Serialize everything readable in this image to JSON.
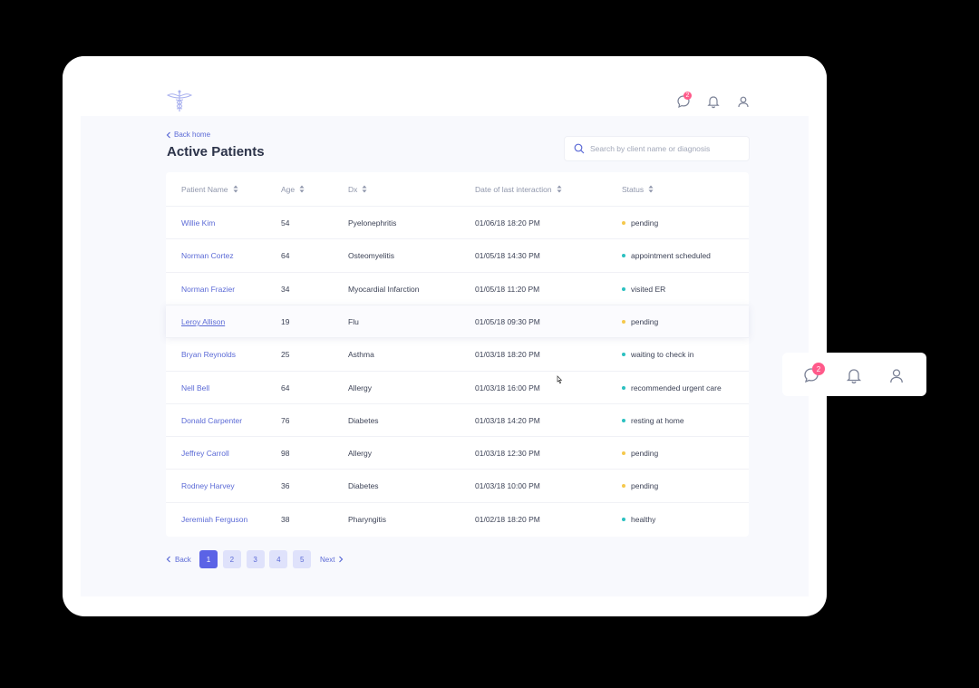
{
  "header": {
    "messages_badge": "2",
    "icons": [
      "chat-icon",
      "bell-icon",
      "user-icon"
    ]
  },
  "page": {
    "back_label": "Back home",
    "title": "Active Patients",
    "search_placeholder": "Search by client name or diagnosis"
  },
  "table": {
    "columns": [
      "Patient Name",
      "Age",
      "Dx",
      "Date of last interaction",
      "Status"
    ],
    "rows": [
      {
        "name": "Willie Kim",
        "age": "54",
        "dx": "Pyelonephritis",
        "date": "01/06/18 18:20 PM",
        "status": "pending",
        "status_color": "#f5c84c"
      },
      {
        "name": "Norman Cortez",
        "age": "64",
        "dx": "Osteomyelitis",
        "date": "01/05/18 14:30 PM",
        "status": "appointment scheduled",
        "status_color": "#2bc0c0"
      },
      {
        "name": "Norman Frazier",
        "age": "34",
        "dx": "Myocardial Infarction",
        "date": "01/05/18 11:20 PM",
        "status": "visited ER",
        "status_color": "#2bc0c0"
      },
      {
        "name": "Leroy Allison",
        "age": "19",
        "dx": "Flu",
        "date": "01/05/18 09:30 PM",
        "status": "pending",
        "status_color": "#f5c84c"
      },
      {
        "name": "Bryan Reynolds",
        "age": "25",
        "dx": "Asthma",
        "date": "01/03/18 18:20 PM",
        "status": "waiting to check in",
        "status_color": "#2bc0c0"
      },
      {
        "name": "Nell Bell",
        "age": "64",
        "dx": "Allergy",
        "date": "01/03/18 16:00 PM",
        "status": "recommended urgent care",
        "status_color": "#2bc0c0"
      },
      {
        "name": "Donald Carpenter",
        "age": "76",
        "dx": "Diabetes",
        "date": "01/03/18 14:20 PM",
        "status": "resting at home",
        "status_color": "#2bc0c0"
      },
      {
        "name": "Jeffrey Carroll",
        "age": "98",
        "dx": "Allergy",
        "date": "01/03/18 12:30 PM",
        "status": "pending",
        "status_color": "#f5c84c"
      },
      {
        "name": "Rodney Harvey",
        "age": "36",
        "dx": "Diabetes",
        "date": "01/03/18 10:00 PM",
        "status": "pending",
        "status_color": "#f5c84c"
      },
      {
        "name": "Jeremiah Ferguson",
        "age": "38",
        "dx": "Pharyngitis",
        "date": "01/02/18 18:20 PM",
        "status": "healthy",
        "status_color": "#2bc0c0"
      }
    ]
  },
  "pagination": {
    "back_label": "Back",
    "next_label": "Next",
    "pages": [
      "1",
      "2",
      "3",
      "4",
      "5"
    ],
    "current": "1"
  },
  "floating_card": {
    "messages_badge": "2",
    "icons": [
      "chat-icon",
      "bell-icon",
      "user-icon"
    ]
  },
  "colors": {
    "accent": "#5b63e6",
    "link": "#5b6ad6",
    "badge": "#ff5a8a",
    "status_pending": "#f5c84c",
    "status_ok": "#2bc0c0"
  }
}
